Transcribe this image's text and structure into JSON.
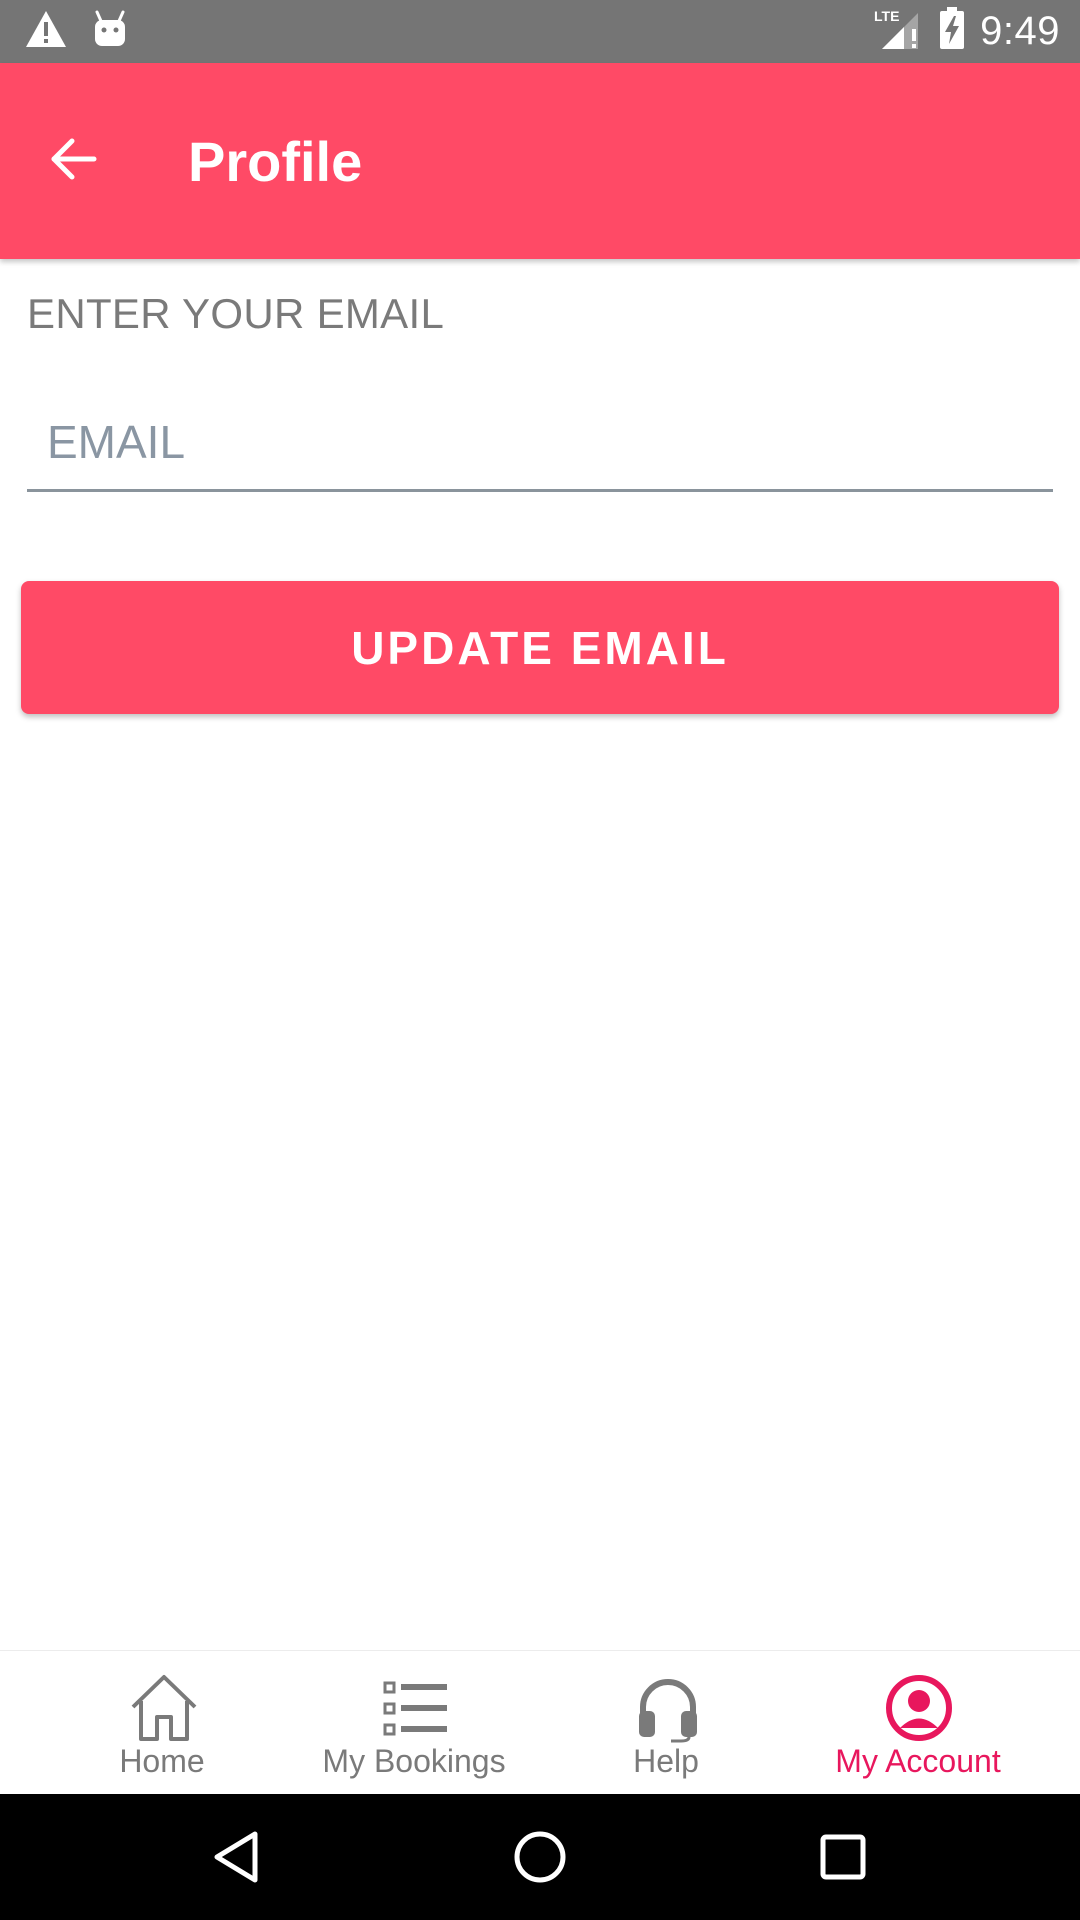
{
  "status_bar": {
    "time": "9:49",
    "left_icons": [
      "warning-icon",
      "android-icon"
    ],
    "right_icons": [
      "lte-signal-icon",
      "battery-charging-icon"
    ],
    "lte_label": "LTE"
  },
  "app_bar": {
    "title": "Profile",
    "back_icon": "arrow-left-icon",
    "color": "#ff4a66"
  },
  "form": {
    "label": "ENTER YOUR EMAIL",
    "email_placeholder": "EMAIL",
    "email_value": "",
    "submit_label": "UPDATE EMAIL"
  },
  "bottom_nav": {
    "active_color": "#e8175d",
    "inactive_color": "#7a7a7a",
    "items": [
      {
        "label": "Home",
        "icon": "home-icon",
        "active": false
      },
      {
        "label": "My Bookings",
        "icon": "list-icon",
        "active": false
      },
      {
        "label": "Help",
        "icon": "headset-icon",
        "active": false
      },
      {
        "label": "My Account",
        "icon": "account-circle-icon",
        "active": true
      }
    ]
  },
  "system_nav": {
    "buttons": [
      "back-triangle-icon",
      "home-circle-icon",
      "recents-square-icon"
    ]
  }
}
